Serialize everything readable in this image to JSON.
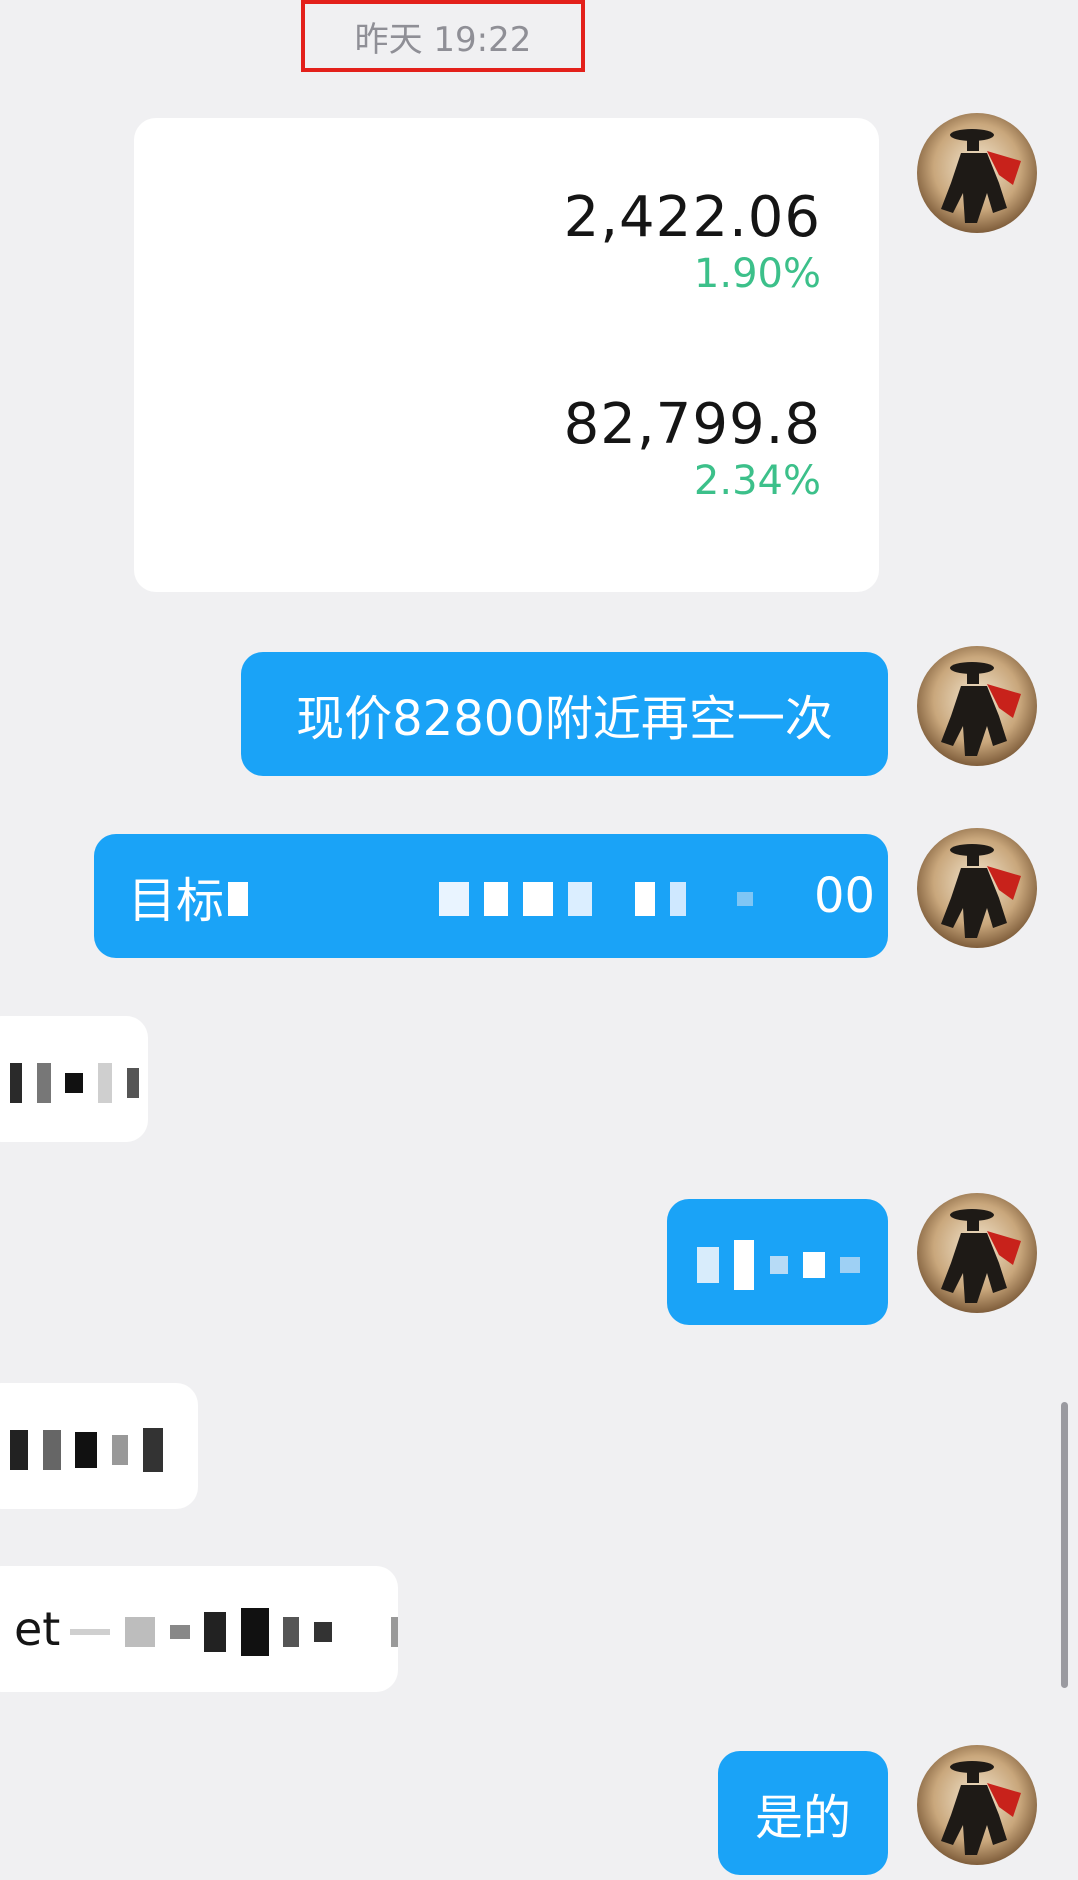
{
  "timestamp": "昨天 19:22",
  "card": {
    "quotes": [
      {
        "price": "2,422.06",
        "change": "1.90%"
      },
      {
        "price": "82,799.8",
        "change": "2.34%"
      }
    ]
  },
  "messages": [
    {
      "side": "right",
      "text": "现价82800附近再空一次"
    },
    {
      "side": "right",
      "text": "目标",
      "tail": "00",
      "redacted": true
    },
    {
      "side": "left",
      "text": "",
      "redacted": true
    },
    {
      "side": "right",
      "text": "",
      "redacted": true
    },
    {
      "side": "left",
      "text": "",
      "redacted": true
    },
    {
      "side": "left",
      "text": "et",
      "redacted": true
    },
    {
      "side": "right",
      "text": "是的"
    }
  ],
  "colors": {
    "bubble_self": "#1aa3f7",
    "bubble_other": "#ffffff",
    "change_up": "#3cc08a",
    "timestamp_highlight": "#e3201b",
    "background": "#f0f0f2"
  },
  "icons": {
    "avatar": "horseman-avatar"
  }
}
